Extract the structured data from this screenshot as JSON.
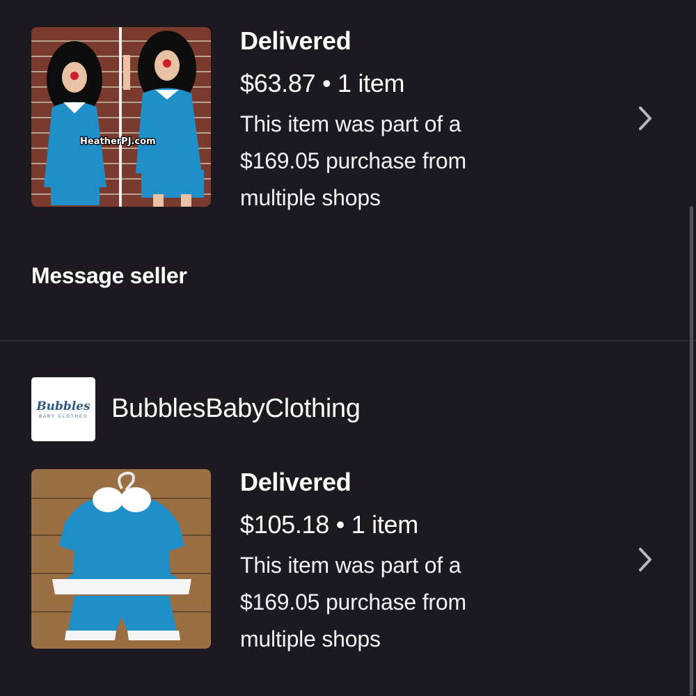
{
  "orders": [
    {
      "status": "Delivered",
      "price_line": "$63.87 • 1 item",
      "note": "This item was part of a $169.05 purchase from multiple shops",
      "watermark": "HeatherPJ.com"
    },
    {
      "status": "Delivered",
      "price_line": "$105.18 • 1 item",
      "note": "This item was part of a $169.05 purchase from multiple shops"
    }
  ],
  "message_seller_label": "Message seller",
  "shop": {
    "name": "BubblesBabyClothing",
    "logo_text": "Bubbles",
    "logo_subtext": "BABY CLOTHES"
  },
  "icons": {
    "chevron": "chevron-right-icon"
  },
  "colors": {
    "background": "#1c1a20",
    "divider": "#3b3940",
    "chevron": "#b9b6bd",
    "product_blue": "#1e8fc8"
  }
}
